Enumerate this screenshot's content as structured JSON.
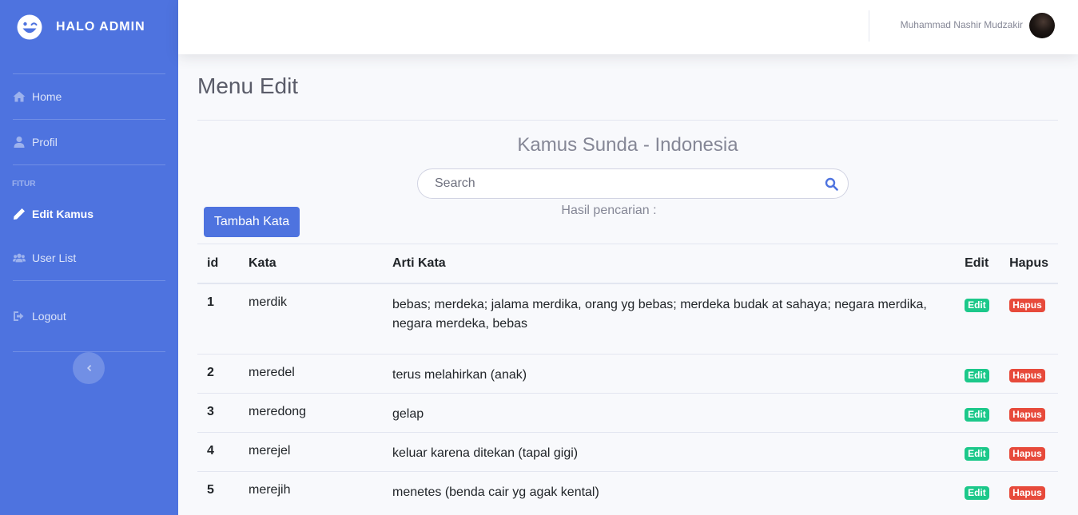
{
  "brand": {
    "name": "HALO ADMIN",
    "icon": "laugh-wink-icon"
  },
  "sidebar": {
    "items": [
      {
        "label": "Home",
        "icon": "home-icon"
      },
      {
        "label": "Profil",
        "icon": "user-icon"
      },
      {
        "heading": "FITUR"
      },
      {
        "label": "Edit Kamus",
        "icon": "pencil-icon",
        "active": true
      },
      {
        "label": "User List",
        "icon": "users-icon"
      },
      {
        "label": "Logout",
        "icon": "sign-out-icon"
      }
    ],
    "toggle_icon": "chevron-left-icon"
  },
  "topbar": {
    "user_name": "Muhammad Nashir Mudzakir"
  },
  "main": {
    "page_title": "Menu Edit",
    "section_title": "Kamus Sunda - Indonesia",
    "search": {
      "placeholder": "Search",
      "value": ""
    },
    "result_label": "Hasil pencarian :",
    "add_button": "Tambah Kata",
    "table": {
      "headers": [
        "id",
        "Kata",
        "Arti Kata",
        "Edit",
        "Hapus"
      ],
      "rows": [
        {
          "id": "1",
          "kata": "merdik",
          "arti": "bebas; merdeka; jalama merdika, orang yg bebas; merdeka budak at sahaya; negara merdika, negara merdeka, bebas",
          "edit": "Edit",
          "hapus": "Hapus"
        },
        {
          "id": "2",
          "kata": "meredel",
          "arti": "terus melahirkan (anak)",
          "edit": "Edit",
          "hapus": "Hapus"
        },
        {
          "id": "3",
          "kata": "meredong",
          "arti": "gelap",
          "edit": "Edit",
          "hapus": "Hapus"
        },
        {
          "id": "4",
          "kata": "merejel",
          "arti": "keluar karena ditekan (tapal gigi)",
          "edit": "Edit",
          "hapus": "Hapus"
        },
        {
          "id": "5",
          "kata": "merejih",
          "arti": "menetes (benda cair yg agak kental)",
          "edit": "Edit",
          "hapus": "Hapus"
        }
      ]
    }
  },
  "colors": {
    "primary": "#4e73df",
    "success": "#1cc88a",
    "danger": "#e74a3b"
  }
}
